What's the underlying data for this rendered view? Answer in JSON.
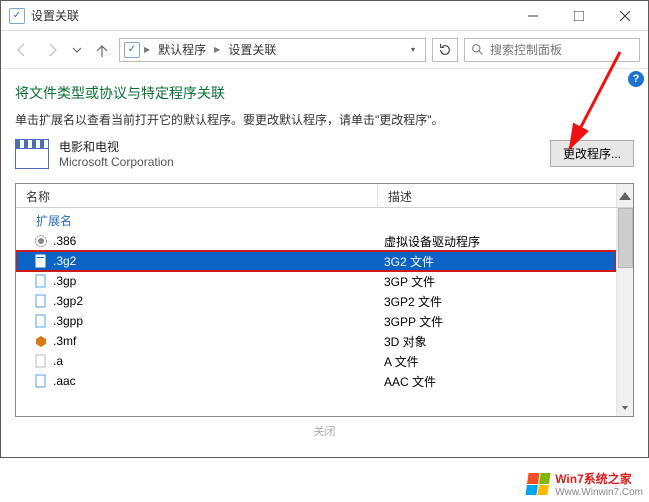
{
  "titlebar": {
    "title": "设置关联"
  },
  "breadcrumbs": {
    "items": [
      "默认程序",
      "设置关联"
    ]
  },
  "search": {
    "placeholder": "搜索控制面板"
  },
  "heading": "将文件类型或协议与特定程序关联",
  "subtext": "单击扩展名以查看当前打开它的默认程序。要更改默认程序，请单击\"更改程序\"。",
  "app": {
    "name": "电影和电视",
    "vendor": "Microsoft Corporation"
  },
  "buttons": {
    "change": "更改程序..."
  },
  "columns": {
    "name": "名称",
    "desc": "描述"
  },
  "group_label": "扩展名",
  "rows": [
    {
      "ext": ".386",
      "desc": "虚拟设备驱动程序",
      "icon": "gear"
    },
    {
      "ext": ".3g2",
      "desc": "3G2 文件",
      "icon": "doc",
      "selected": true
    },
    {
      "ext": ".3gp",
      "desc": "3GP 文件",
      "icon": "doc"
    },
    {
      "ext": ".3gp2",
      "desc": "3GP2 文件",
      "icon": "doc"
    },
    {
      "ext": ".3gpp",
      "desc": "3GPP 文件",
      "icon": "doc"
    },
    {
      "ext": ".3mf",
      "desc": "3D 对象",
      "icon": "cube"
    },
    {
      "ext": ".a",
      "desc": "A 文件",
      "icon": "doc"
    },
    {
      "ext": ".aac",
      "desc": "AAC 文件",
      "icon": "doc"
    }
  ],
  "footer": {
    "close": "关闭"
  },
  "watermark": {
    "brand": "Win7系统之家",
    "url": "Www.Winwin7.Com"
  },
  "annotation": {
    "arrow_color": "#e11"
  }
}
